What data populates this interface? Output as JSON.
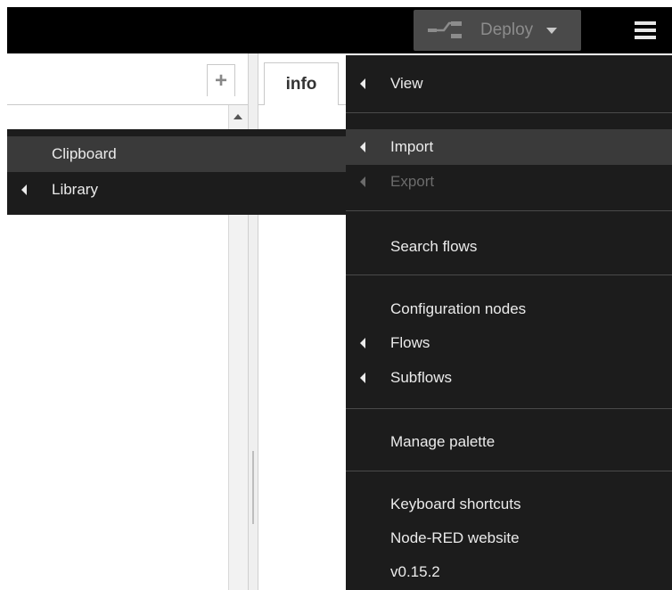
{
  "header": {
    "deploy_label": "Deploy",
    "deploy_icon": "deploy-icon",
    "menu_icon": "hamburger-menu-icon"
  },
  "workspace": {
    "add_tab_label": "+"
  },
  "sidebar": {
    "tabs": [
      {
        "label": "info"
      }
    ]
  },
  "main_menu": {
    "items": [
      {
        "label": "View",
        "has_submenu": true
      },
      {
        "label": "Import",
        "has_submenu": true,
        "highlighted": true
      },
      {
        "label": "Export",
        "has_submenu": true,
        "disabled": true
      },
      {
        "label": "Search flows"
      },
      {
        "label": "Configuration nodes"
      },
      {
        "label": "Flows",
        "has_submenu": true
      },
      {
        "label": "Subflows",
        "has_submenu": true
      },
      {
        "label": "Manage palette"
      },
      {
        "label": "Keyboard shortcuts"
      },
      {
        "label": "Node-RED website"
      },
      {
        "label": "v0.15.2"
      }
    ]
  },
  "import_submenu": {
    "items": [
      {
        "label": "Clipboard",
        "highlighted": true
      },
      {
        "label": "Library",
        "has_submenu": true
      }
    ]
  },
  "colors": {
    "header_bg": "#000000",
    "menu_bg": "#1c1c1c",
    "menu_highlight": "#3a3a3a",
    "menu_text": "#ebebeb",
    "menu_disabled": "#6b6b6b",
    "deploy_bg": "#4a4a4a"
  }
}
